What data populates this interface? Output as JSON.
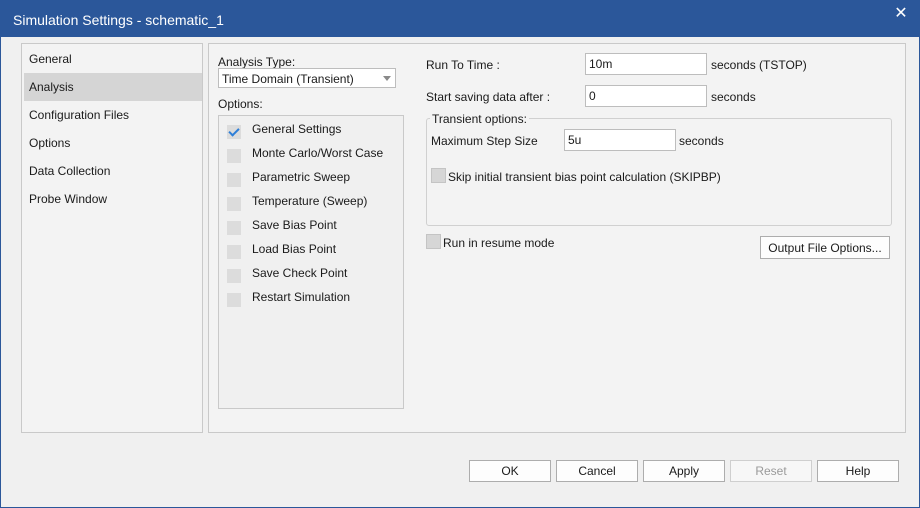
{
  "window": {
    "title": "Simulation Settings - schematic_1",
    "close_symbol": "✕"
  },
  "nav": {
    "items": [
      {
        "label": "General"
      },
      {
        "label": "Analysis"
      },
      {
        "label": "Configuration Files"
      },
      {
        "label": "Options"
      },
      {
        "label": "Data Collection"
      },
      {
        "label": "Probe Window"
      }
    ],
    "selected": "Analysis"
  },
  "analysis": {
    "type_label": "Analysis Type:",
    "type_value": "Time Domain (Transient)",
    "options_label": "Options:",
    "options": [
      {
        "label": "General Settings",
        "checked": true
      },
      {
        "label": "Monte Carlo/Worst Case",
        "checked": false
      },
      {
        "label": "Parametric Sweep",
        "checked": false
      },
      {
        "label": "Temperature (Sweep)",
        "checked": false
      },
      {
        "label": "Save Bias Point",
        "checked": false
      },
      {
        "label": "Load Bias Point",
        "checked": false
      },
      {
        "label": "Save Check Point",
        "checked": false
      },
      {
        "label": "Restart Simulation",
        "checked": false
      }
    ]
  },
  "settings": {
    "run_to_time_label": "Run To Time :",
    "run_to_time_value": "10m",
    "run_to_time_unit": "seconds (TSTOP)",
    "start_saving_label": "Start saving data after :",
    "start_saving_value": "0",
    "start_saving_unit": "seconds",
    "transient_group_label": "Transient options:",
    "max_step_label": "Maximum Step Size",
    "max_step_value": "5u",
    "max_step_unit": "seconds",
    "skip_bias_label": "Skip initial transient bias point calculation (SKIPBP)",
    "resume_label": "Run in resume mode",
    "output_file_options_label": "Output File Options..."
  },
  "buttons": {
    "ok": "OK",
    "cancel": "Cancel",
    "apply": "Apply",
    "reset": "Reset",
    "help": "Help"
  },
  "colors": {
    "titlebar": "#2b579a",
    "check": "#2f7fd8",
    "selected_nav": "#d5d5d5"
  }
}
